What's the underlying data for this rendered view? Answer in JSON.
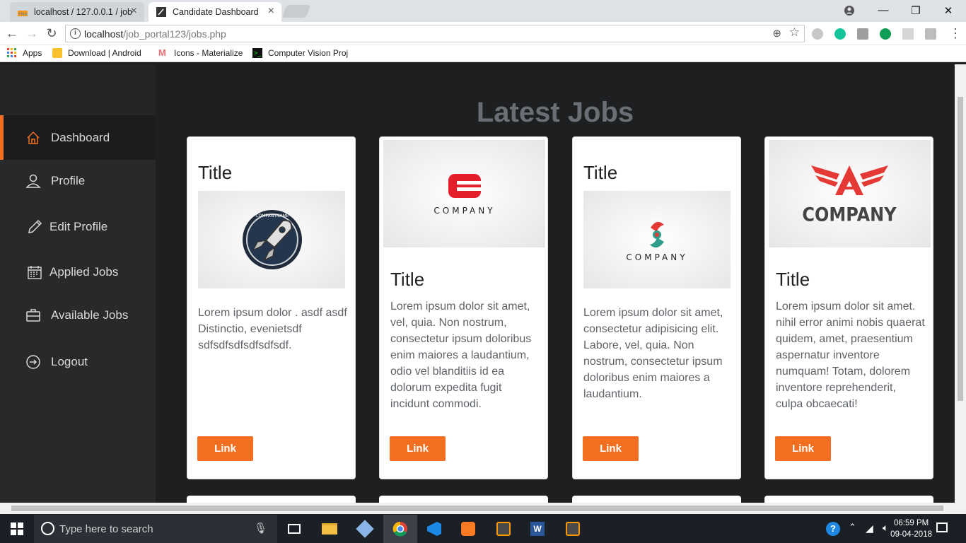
{
  "browser": {
    "tabs": [
      {
        "label": "localhost / 127.0.0.1 / job",
        "favicon": "phpmyadmin-icon"
      },
      {
        "label": "Candidate Dashboard",
        "favicon": "page-icon"
      }
    ],
    "url_host": "localhost",
    "url_path": "/job_portal123/jobs.php",
    "bookmarks": [
      {
        "label": "Apps"
      },
      {
        "label": "Download | Android"
      },
      {
        "label": "Icons - Materialize"
      },
      {
        "label": "Computer Vision Proj"
      }
    ]
  },
  "sidebar": {
    "items": [
      {
        "label": "Dashboard",
        "icon": "home-icon",
        "active": true
      },
      {
        "label": "Profile",
        "icon": "user-icon",
        "active": false
      },
      {
        "label": "Edit Profile",
        "icon": "pencil-icon",
        "active": false
      },
      {
        "label": "Applied Jobs",
        "icon": "calendar-icon",
        "active": false
      },
      {
        "label": "Available Jobs",
        "icon": "briefcase-icon",
        "active": false
      },
      {
        "label": "Logout",
        "icon": "logout-icon",
        "active": false
      }
    ]
  },
  "main": {
    "heading": "Latest Jobs",
    "cards": [
      {
        "title": "Title",
        "logo_text": "COMPANYNAME",
        "description": "Lorem ipsum dolor . asdf asdf Distinctio, evenietsdf sdfsdfsdfsdfsdfsdf.",
        "link": "Link"
      },
      {
        "title": "Title",
        "logo_text": "COMPANY",
        "description": "Lorem ipsum dolor sit amet, vel, quia. Non nostrum, consectetur ipsum doloribus enim maiores a laudantium, odio vel blanditiis id ea dolorum expedita fugit incidunt commodi.",
        "link": "Link"
      },
      {
        "title": "Title",
        "logo_text": "COMPANY",
        "description": "Lorem ipsum dolor sit amet, consectetur adipisicing elit. Labore, vel, quia. Non nostrum, consectetur ipsum doloribus enim maiores a laudantium.",
        "link": "Link"
      },
      {
        "title": "Title",
        "logo_text": "COMPANY",
        "description": "Lorem ipsum dolor sit amet. nihil error animi nobis quaerat quidem, amet, praesentium aspernatur inventore numquam! Totam, dolorem inventore reprehenderit, culpa obcaecati!",
        "link": "Link"
      }
    ]
  },
  "taskbar": {
    "search_placeholder": "Type here to search",
    "time": "06:59 PM",
    "date": "09-04-2018"
  },
  "colors": {
    "accent": "#f26f21",
    "sidebar_bg": "#28292b",
    "page_bg": "#1e1f21"
  }
}
